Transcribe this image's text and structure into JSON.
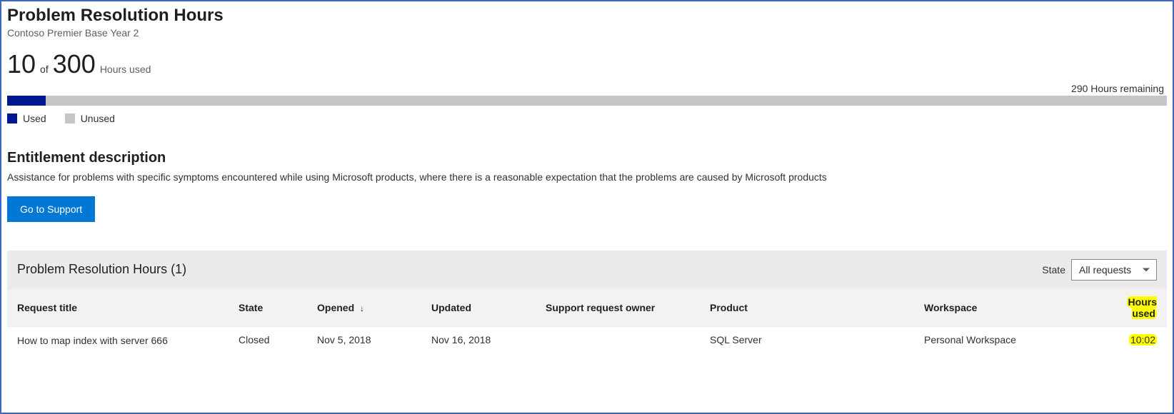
{
  "header": {
    "title": "Problem Resolution Hours",
    "subtitle": "Contoso Premier Base Year 2"
  },
  "usage": {
    "used": "10",
    "of_label": "of",
    "total": "300",
    "used_label": "Hours used",
    "remaining_text": "290 Hours remaining",
    "percent_used": 3.33
  },
  "legend": {
    "used": "Used",
    "unused": "Unused"
  },
  "entitlement": {
    "title": "Entitlement description",
    "text": "Assistance for problems with specific symptoms encountered while using Microsoft products, where there is a reasonable expectation that the problems are caused by Microsoft products",
    "button": "Go to Support"
  },
  "table": {
    "title": "Problem Resolution Hours (1)",
    "state_label": "State",
    "state_selected": "All requests",
    "columns": {
      "request_title": "Request title",
      "state": "State",
      "opened": "Opened",
      "updated": "Updated",
      "owner": "Support request owner",
      "product": "Product",
      "workspace": "Workspace",
      "hours_used": "Hours used"
    },
    "rows": [
      {
        "title": "How to map index with server 666",
        "state": "Closed",
        "opened": "Nov 5, 2018",
        "updated": "Nov 16, 2018",
        "owner": "",
        "product": "SQL Server",
        "workspace": "Personal Workspace",
        "hours_used": "10:02"
      }
    ]
  },
  "chart_data": {
    "type": "bar",
    "categories": [
      "Used",
      "Unused"
    ],
    "values": [
      10,
      290
    ],
    "title": "Problem Resolution Hours",
    "xlabel": "",
    "ylabel": "Hours",
    "ylim": [
      0,
      300
    ]
  }
}
